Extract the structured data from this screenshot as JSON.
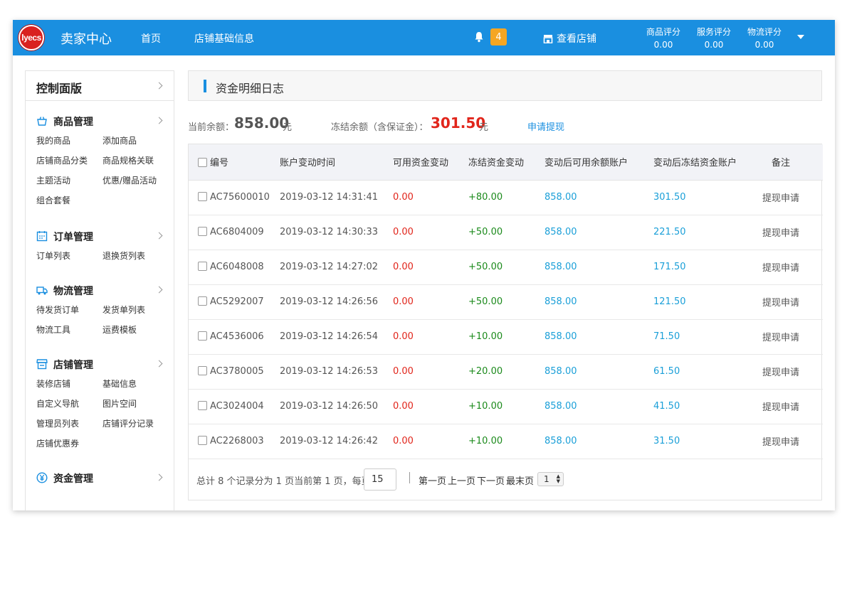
{
  "header": {
    "logo_text": "lyecs",
    "app_title": "卖家中心",
    "nav": [
      "首页",
      "店铺基础信息"
    ],
    "notification_count": "4",
    "view_shop": "查看店铺",
    "scores": [
      {
        "label": "商品评分",
        "value": "0.00"
      },
      {
        "label": "服务评分",
        "value": "0.00"
      },
      {
        "label": "物流评分",
        "value": "0.00"
      }
    ]
  },
  "sidebar": {
    "title": "控制面版",
    "sections": [
      {
        "title": "商品管理",
        "icon": "basket-icon",
        "items": [
          "我的商品",
          "添加商品",
          "店铺商品分类",
          "商品规格关联",
          "主题活动",
          "优惠/赠品活动",
          "组合套餐"
        ]
      },
      {
        "title": "订单管理",
        "icon": "calendar-icon",
        "items": [
          "订单列表",
          "退换货列表"
        ]
      },
      {
        "title": "物流管理",
        "icon": "truck-icon",
        "items": [
          "待发货订单",
          "发货单列表",
          "物流工具",
          "运费模板"
        ]
      },
      {
        "title": "店铺管理",
        "icon": "store-icon",
        "items": [
          "装修店铺",
          "基础信息",
          "自定义导航",
          "图片空间",
          "管理员列表",
          "店铺评分记录",
          "店铺优惠券"
        ]
      },
      {
        "title": "资金管理",
        "icon": "yen-icon",
        "items": []
      }
    ]
  },
  "page": {
    "title": "资金明细日志",
    "balance_label": "当前余额：",
    "balance_value": "858.00",
    "balance_unit": "元",
    "frozen_label": "冻结余额（含保证金）：",
    "frozen_value": "301.50",
    "frozen_unit": "元",
    "withdraw_link": "申请提现"
  },
  "table": {
    "columns": [
      "编号",
      "账户变动时间",
      "可用资金变动",
      "冻结资金变动",
      "变动后可用余额账户",
      "变动后冻结资金账户",
      "备注"
    ],
    "rows": [
      [
        "AC75600010",
        "2019-03-12 14:31:41",
        "0.00",
        "+80.00",
        "858.00",
        "301.50",
        "提现申请"
      ],
      [
        "AC6804009",
        "2019-03-12 14:30:33",
        "0.00",
        "+50.00",
        "858.00",
        "221.50",
        "提现申请"
      ],
      [
        "AC6048008",
        "2019-03-12 14:27:02",
        "0.00",
        "+50.00",
        "858.00",
        "171.50",
        "提现申请"
      ],
      [
        "AC5292007",
        "2019-03-12 14:26:56",
        "0.00",
        "+50.00",
        "858.00",
        "121.50",
        "提现申请"
      ],
      [
        "AC4536006",
        "2019-03-12 14:26:54",
        "0.00",
        "+10.00",
        "858.00",
        "71.50",
        "提现申请"
      ],
      [
        "AC3780005",
        "2019-03-12 14:26:53",
        "0.00",
        "+20.00",
        "858.00",
        "61.50",
        "提现申请"
      ],
      [
        "AC3024004",
        "2019-03-12 14:26:50",
        "0.00",
        "+10.00",
        "858.00",
        "41.50",
        "提现申请"
      ],
      [
        "AC2268003",
        "2019-03-12 14:26:42",
        "0.00",
        "+10.00",
        "858.00",
        "31.50",
        "提现申请"
      ]
    ]
  },
  "pager": {
    "summary": "总计 8 个记录分为 1 页当前第 1 页，每页",
    "page_size": "15",
    "first": "第一页",
    "prev": "上一页",
    "next": "下一页",
    "last": "末页",
    "last_prefix": "最",
    "current_page": "1"
  },
  "colors": {
    "brand": "#1a8fe0",
    "badge": "#f5a623",
    "negative": "#e1251b",
    "positive": "#1b8a1b",
    "account": "#1a9fd8"
  }
}
